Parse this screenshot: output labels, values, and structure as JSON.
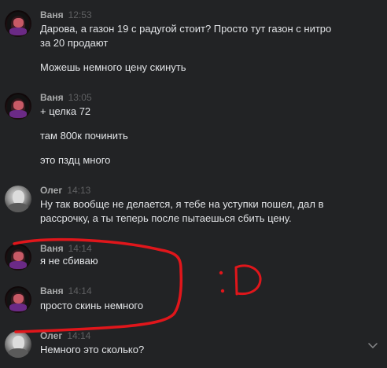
{
  "messages": [
    {
      "author": "Ваня",
      "time": "12:53",
      "lines": [
        "Дарова, а газон 19 с радугой стоит? Просто тут газон с нитро за 20 продают",
        "Можешь немного цену скинуть"
      ]
    },
    {
      "author": "Ваня",
      "time": "13:05",
      "lines": [
        "+ целка 72",
        "там 800к починить",
        "это пздц много"
      ]
    },
    {
      "author": "Олег",
      "time": "14:13",
      "lines": [
        "Ну так вообще не делается, я тебе на уступки пошел, дал в рассрочку, а ты теперь после пытаешься сбить цену."
      ]
    },
    {
      "author": "Ваня",
      "time": "14:14",
      "lines": [
        "я не сбиваю"
      ]
    },
    {
      "author": "Ваня",
      "time": "14:14",
      "lines": [
        "просто скинь немного"
      ]
    },
    {
      "author": "Олег",
      "time": "14:14",
      "lines": [
        "Немного это сколько?"
      ]
    }
  ],
  "annotation": {
    "color": "#e0161b",
    "drawn_text": ":D"
  },
  "colors": {
    "background": "#222325",
    "author": "#a9aaab",
    "time": "#5f6062",
    "text": "#e1e3e6"
  },
  "icons": {
    "scroll_down": "chevron-down-icon"
  }
}
